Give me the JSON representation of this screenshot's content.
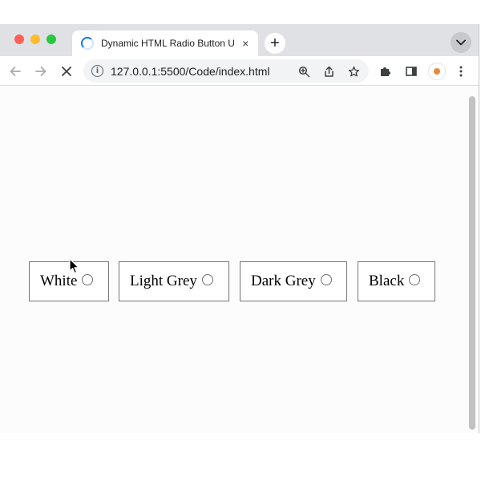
{
  "browser": {
    "tab": {
      "title": "Dynamic HTML Radio Button U",
      "close_label": "×"
    },
    "new_tab_label": "+",
    "address": {
      "url": "127.0.0.1:5500/Code/index.html"
    }
  },
  "page": {
    "options": [
      {
        "label": "White",
        "selected": false
      },
      {
        "label": "Light Grey",
        "selected": false
      },
      {
        "label": "Dark Grey",
        "selected": false
      },
      {
        "label": "Black",
        "selected": false
      }
    ]
  },
  "colors": {
    "page_background": "#fcfcfd",
    "tabstrip": "#dfe1e5",
    "spinner": "#1a73e8"
  }
}
